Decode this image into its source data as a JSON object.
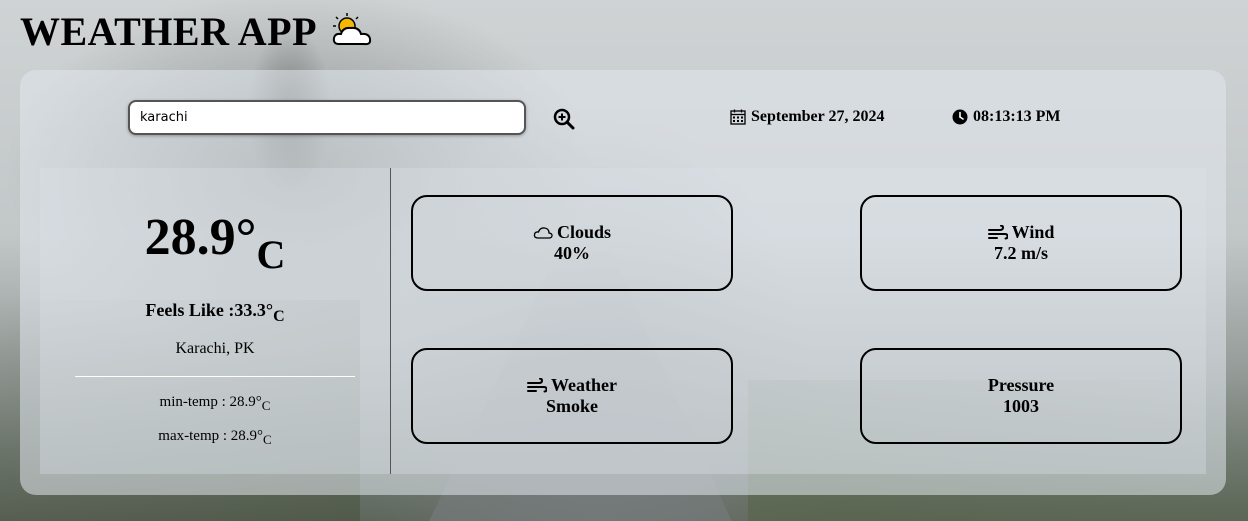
{
  "app": {
    "title": "WEATHER APP",
    "title_icon": "sun-behind-cloud-icon"
  },
  "search": {
    "value": "karachi",
    "button_icon": "search-zoom-icon"
  },
  "datetime": {
    "date": "September 27, 2024",
    "date_icon": "calendar-icon",
    "time": "08:13:13 PM",
    "time_icon": "clock-icon"
  },
  "current": {
    "temp_value": "28.9°",
    "temp_unit": "C",
    "feels_label": "Feels Like :",
    "feels_value": "33.3°",
    "feels_unit": "C",
    "location": "Karachi, PK",
    "min_label": "min-temp : ",
    "min_value": "28.9°",
    "min_unit": "C",
    "max_label": "max-temp : ",
    "max_value": "28.9°",
    "max_unit": "C"
  },
  "cards": {
    "clouds": {
      "label": "Clouds",
      "value": "40%",
      "icon": "cloud-icon"
    },
    "wind": {
      "label": "Wind",
      "value": "7.2 m/s",
      "icon": "wind-icon"
    },
    "weather": {
      "label": "Weather",
      "value": "Smoke",
      "icon": "wind-icon"
    },
    "pressure": {
      "label": "Pressure",
      "value": "1003"
    }
  },
  "colors": {
    "text": "#000000",
    "panel": "#e1e8ee",
    "sun": "#f5b800"
  }
}
